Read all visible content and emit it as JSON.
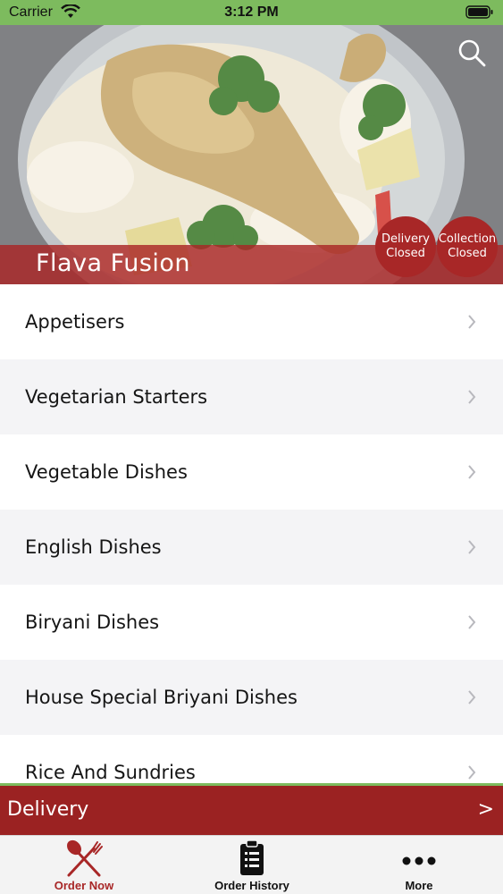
{
  "status_bar": {
    "carrier": "Carrier",
    "time": "3:12 PM"
  },
  "hero": {
    "restaurant_name": "Flava Fusion",
    "delivery_badge": {
      "line1": "Delivery",
      "line2": "Closed"
    },
    "collection_badge": {
      "line1": "Collection",
      "line2": "Closed"
    },
    "search_icon": "search-icon"
  },
  "categories": [
    {
      "label": "Appetisers"
    },
    {
      "label": "Vegetarian Starters"
    },
    {
      "label": "Vegetable Dishes"
    },
    {
      "label": "English Dishes"
    },
    {
      "label": "Biryani Dishes"
    },
    {
      "label": "House Special Briyani Dishes"
    },
    {
      "label": "Rice And Sundries"
    }
  ],
  "delivery_bar": {
    "label": "Delivery",
    "arrow": ">"
  },
  "tabs": [
    {
      "label": "Order Now",
      "icon": "fork-knife-icon",
      "active": true
    },
    {
      "label": "Order History",
      "icon": "clipboard-icon",
      "active": false
    },
    {
      "label": "More",
      "icon": "more-dots-icon",
      "active": false
    }
  ],
  "colors": {
    "accent_red": "#a82727",
    "status_green": "#7dbb5e",
    "delivery_bar": "#9b2222"
  }
}
